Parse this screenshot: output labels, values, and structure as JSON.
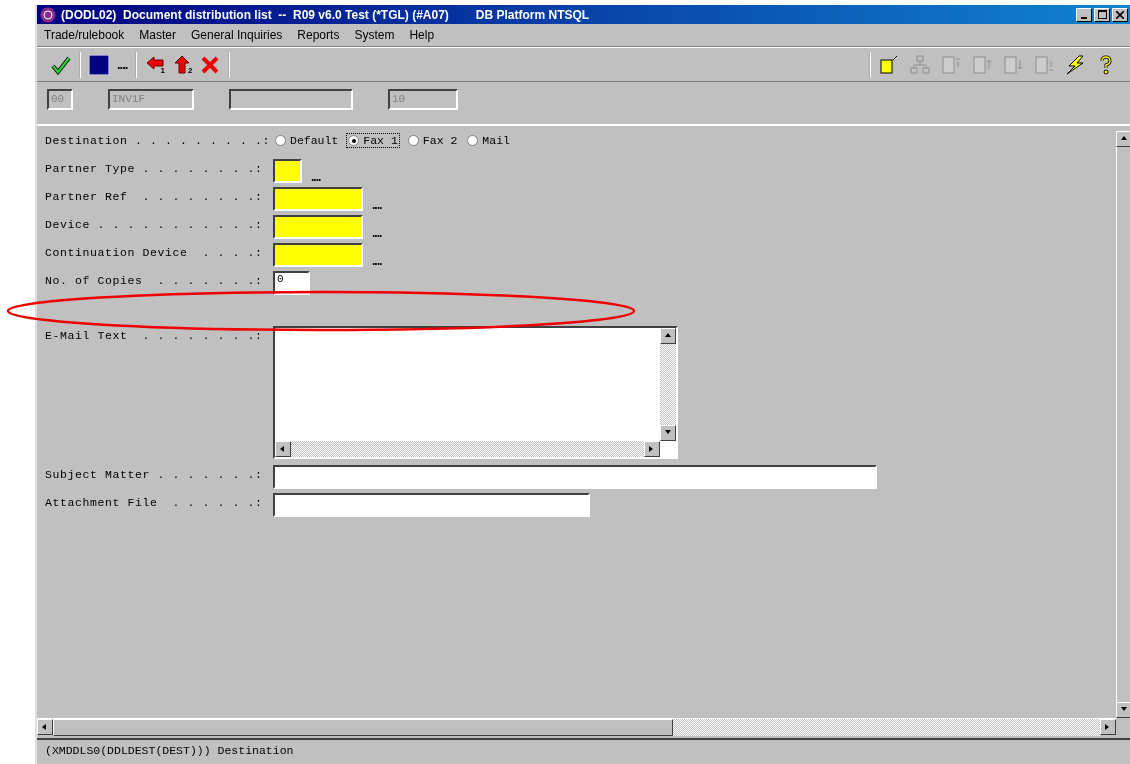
{
  "window": {
    "title": "(DODL02)  Document distribution list  --  R09 v6.0 Test (*TGL) (#A07)",
    "platform": "DB Platform NTSQL"
  },
  "menu": [
    "Trade/rulebook",
    "Master",
    "General Inquiries",
    "Reports",
    "System",
    "Help"
  ],
  "toolbar_left": [
    {
      "kind": "check"
    },
    {
      "kind": "color"
    },
    {
      "kind": "ellipsis",
      "label": "...."
    },
    {
      "kind": "back",
      "badge": "1"
    },
    {
      "kind": "up",
      "badge": "2"
    },
    {
      "kind": "cancel"
    }
  ],
  "toolbar_right": [
    {
      "kind": "new",
      "disabled": false
    },
    {
      "kind": "tree",
      "disabled": true
    },
    {
      "kind": "first",
      "disabled": true
    },
    {
      "kind": "prev",
      "disabled": true
    },
    {
      "kind": "next",
      "disabled": true
    },
    {
      "kind": "last",
      "disabled": true
    },
    {
      "kind": "run",
      "disabled": false
    },
    {
      "kind": "help",
      "disabled": false
    }
  ],
  "header_fields": [
    {
      "value": "00",
      "disabled": true
    },
    {
      "value": "INV1F",
      "disabled": true
    },
    {
      "disabled": true
    },
    {
      "value": "10",
      "disabled": true
    }
  ],
  "form": [
    {
      "kind": "radio",
      "label": "Destination . . . . . . . . .:",
      "options": [
        {
          "label": "Default",
          "selected": false,
          "focused": false
        },
        {
          "label": "Fax 1",
          "selected": true,
          "focused": true
        },
        {
          "label": "Fax 2",
          "selected": false,
          "focused": false
        },
        {
          "label": "Mail",
          "selected": false,
          "focused": false
        }
      ]
    },
    {
      "kind": "lookup",
      "label": "Partner Type . . . . . . . .:",
      "required": true,
      "button": "...."
    },
    {
      "kind": "lookup",
      "label": "Partner Ref  . . . . . . . .:",
      "required": true,
      "button": "...."
    },
    {
      "kind": "lookup",
      "label": "Device . . . . . . . . . . .:",
      "required": true,
      "button": "...."
    },
    {
      "kind": "lookup",
      "label": "Continuation Device  . . . .:",
      "required": true,
      "button": "...."
    },
    {
      "kind": "text",
      "label": "No. of Copies  . . . . . . .:",
      "required": false,
      "value": "0"
    },
    {
      "kind": "memo",
      "label": "E-Mail Text  . . . . . . . .:"
    },
    {
      "kind": "text",
      "label": "Subject Matter . . . . . . .:",
      "required": false
    },
    {
      "kind": "text",
      "label": "Attachment File  . . . . . .:",
      "required": false
    }
  ],
  "status_bar": {
    "text": "(XMDDLS0(DDLDEST(DEST))) Destination"
  }
}
